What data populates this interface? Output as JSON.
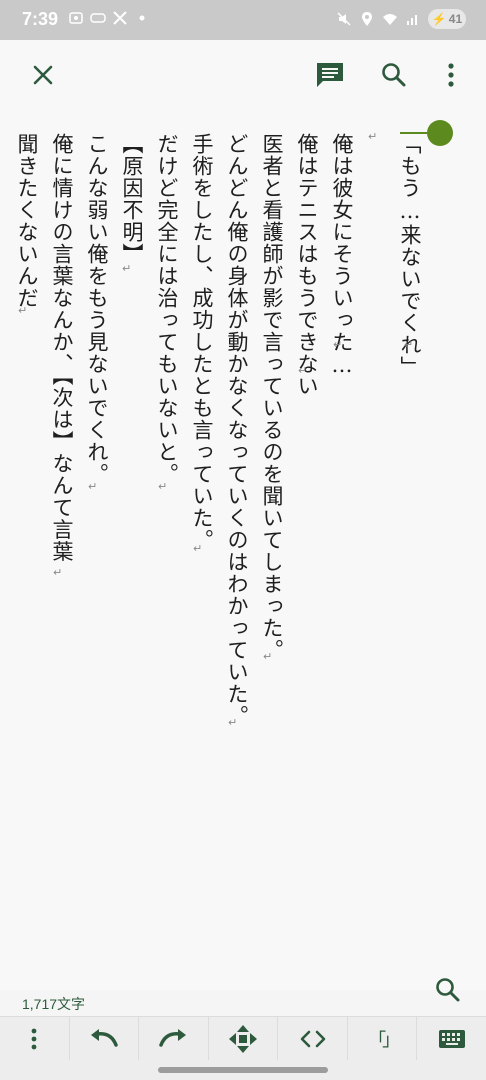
{
  "status": {
    "time": "7:39",
    "battery": "41"
  },
  "editor": {
    "lines": [
      "「もう…来ないでくれ」",
      "",
      "俺は彼女にそういった…",
      "俺はテニスはもうできない",
      "医者と看護師が影で言っているのを聞いてしまった。",
      "どんどん俺の身体が動かなくなっていくのはわかっていた。",
      "手術をしたし、成功したとも言っていた。",
      "だけど完全には治ってもいないと。",
      "【原因不明】",
      "こんな弱い俺をもう見ないでくれ。",
      "俺に情けの言葉なんか、【次は】なんて言葉",
      "聞きたくないんだ"
    ],
    "return_mark": "↵",
    "char_count": "1,717文字"
  },
  "toolbar": {
    "bracket_label": "「」",
    "code_label": "<>"
  },
  "colors": {
    "accent": "#2d5a3d",
    "pin": "#5d8a1e"
  },
  "icons": {
    "close": "close-icon",
    "comment": "comment-icon",
    "search": "search-icon",
    "more": "more-vert-icon",
    "undo": "undo-icon",
    "redo": "redo-icon",
    "move": "move-arrows-icon",
    "keyboard": "keyboard-icon"
  }
}
